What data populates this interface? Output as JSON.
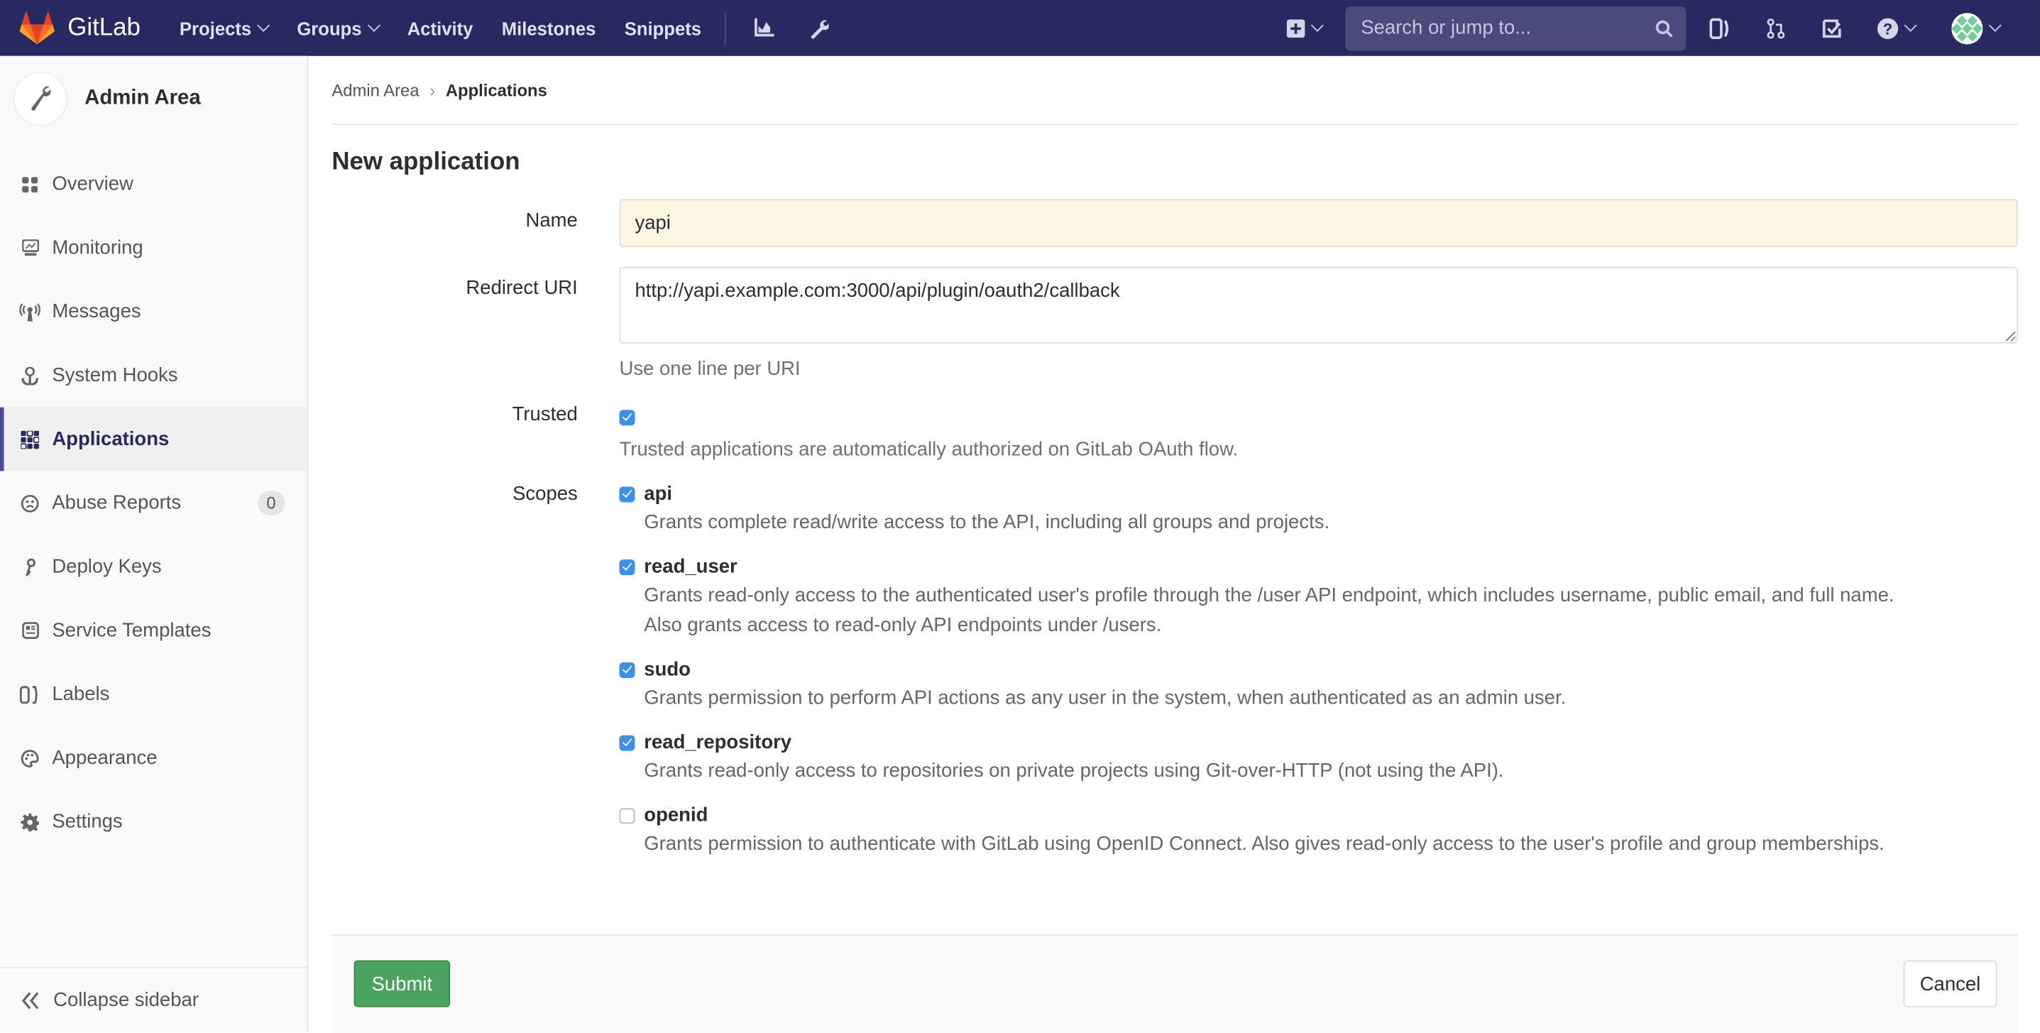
{
  "navbar": {
    "brand": "GitLab",
    "links": [
      {
        "label": "Projects",
        "dropdown": true
      },
      {
        "label": "Groups",
        "dropdown": true
      },
      {
        "label": "Activity",
        "dropdown": false
      },
      {
        "label": "Milestones",
        "dropdown": false
      },
      {
        "label": "Snippets",
        "dropdown": false
      }
    ],
    "search_placeholder": "Search or jump to...",
    "colors": {
      "bg": "#292961",
      "search_bg": "#4a4a7b"
    }
  },
  "sidebar": {
    "title": "Admin Area",
    "items": [
      {
        "label": "Overview",
        "icon": "overview-icon"
      },
      {
        "label": "Monitoring",
        "icon": "monitor-icon"
      },
      {
        "label": "Messages",
        "icon": "broadcast-icon"
      },
      {
        "label": "System Hooks",
        "icon": "hook-icon"
      },
      {
        "label": "Applications",
        "icon": "applications-icon",
        "active": true
      },
      {
        "label": "Abuse Reports",
        "icon": "frown-icon",
        "badge": "0"
      },
      {
        "label": "Deploy Keys",
        "icon": "key-icon"
      },
      {
        "label": "Service Templates",
        "icon": "template-icon"
      },
      {
        "label": "Labels",
        "icon": "labels-icon"
      },
      {
        "label": "Appearance",
        "icon": "palette-icon"
      },
      {
        "label": "Settings",
        "icon": "gear-icon"
      }
    ],
    "collapse_label": "Collapse sidebar"
  },
  "breadcrumb": {
    "parent": "Admin Area",
    "current": "Applications"
  },
  "form": {
    "title": "New application",
    "name_label": "Name",
    "name_value": "yapi",
    "redirect_label": "Redirect URI",
    "redirect_value": "http://yapi.example.com:3000/api/plugin/oauth2/callback",
    "redirect_help": "Use one line per URI",
    "trusted_label": "Trusted",
    "trusted_checked": true,
    "trusted_help": "Trusted applications are automatically authorized on GitLab OAuth flow.",
    "scopes_label": "Scopes",
    "scopes": [
      {
        "name": "api",
        "checked": true,
        "desc": [
          "Grants complete read/write access to the API, including all groups and projects."
        ]
      },
      {
        "name": "read_user",
        "checked": true,
        "desc": [
          "Grants read-only access to the authenticated user's profile through the /user API endpoint, which includes username, public email, and full name.",
          "Also grants access to read-only API endpoints under /users."
        ]
      },
      {
        "name": "sudo",
        "checked": true,
        "desc": [
          "Grants permission to perform API actions as any user in the system, when authenticated as an admin user."
        ]
      },
      {
        "name": "read_repository",
        "checked": true,
        "desc": [
          "Grants read-only access to repositories on private projects using Git-over-HTTP (not using the API)."
        ]
      },
      {
        "name": "openid",
        "checked": false,
        "desc": [
          "Grants permission to authenticate with GitLab using OpenID Connect. Also gives read-only access to the user's profile and group memberships."
        ]
      }
    ],
    "submit_label": "Submit",
    "cancel_label": "Cancel",
    "colors": {
      "submit": "#4aa35e",
      "checkbox": "#3b8ff0",
      "name_bg": "#fcf6e2"
    }
  }
}
